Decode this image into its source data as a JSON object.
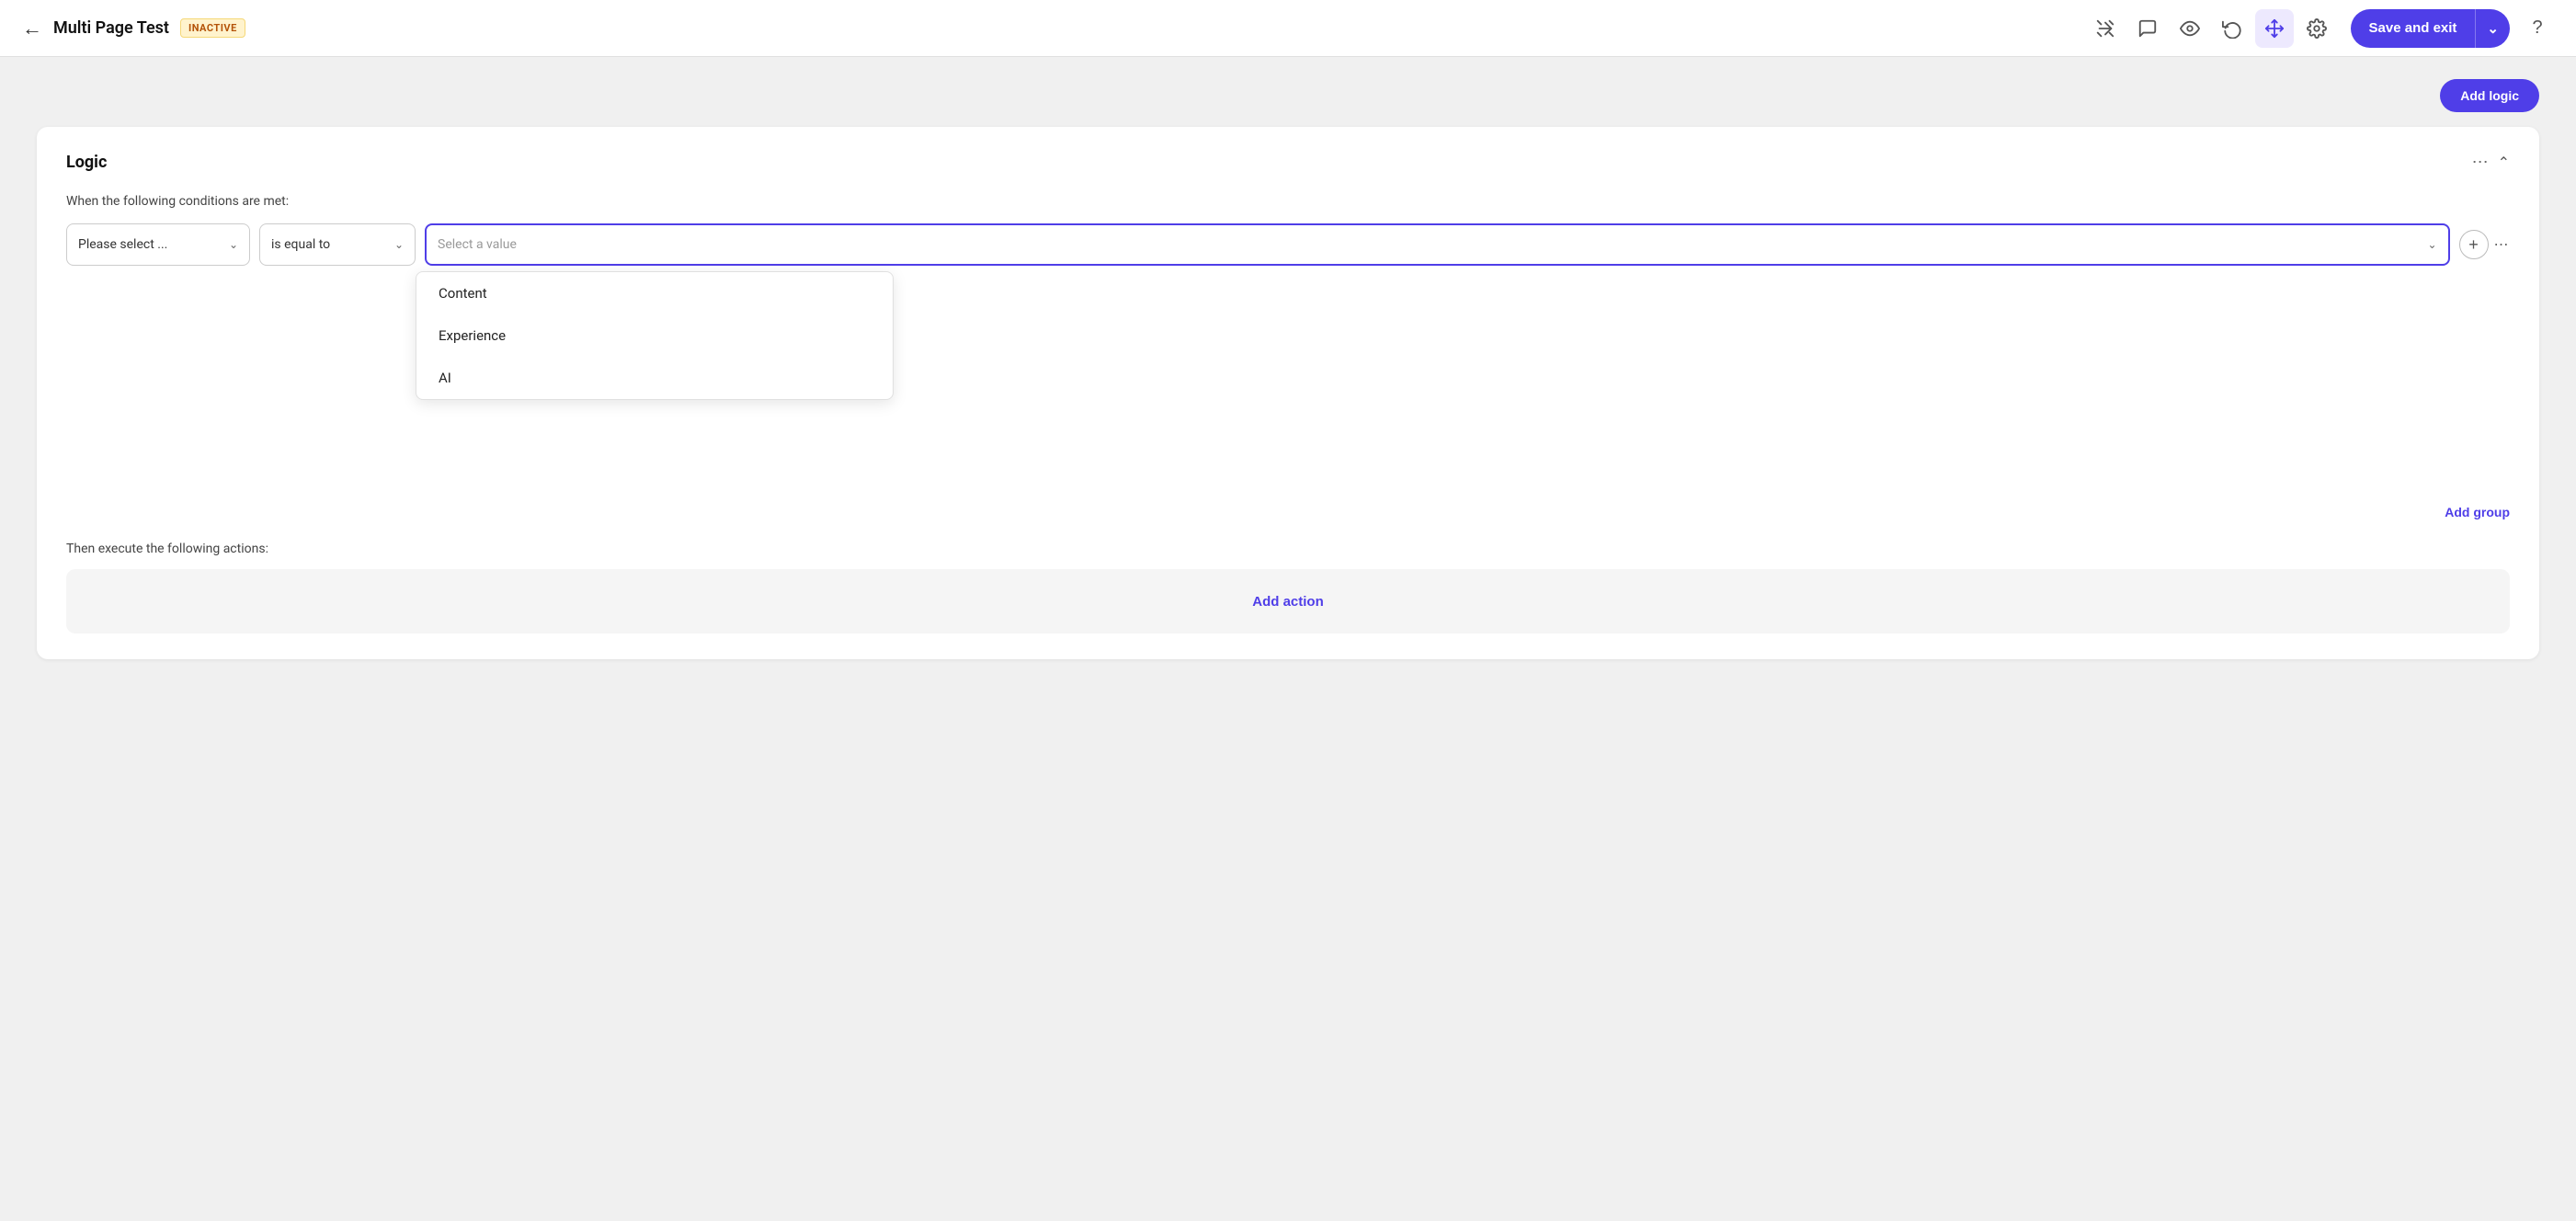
{
  "header": {
    "back_label": "←",
    "title": "Multi Page Test",
    "badge": "INACTIVE",
    "icons": [
      {
        "name": "wand-icon",
        "symbol": "✂️",
        "active": false
      },
      {
        "name": "chat-icon",
        "symbol": "💬",
        "active": false
      },
      {
        "name": "eye-icon",
        "symbol": "👁",
        "active": false
      },
      {
        "name": "history-icon",
        "symbol": "⏱",
        "active": false
      },
      {
        "name": "move-icon",
        "symbol": "✦",
        "active": true
      },
      {
        "name": "gear-icon",
        "symbol": "⚙",
        "active": false
      }
    ],
    "save_exit_label": "Save and exit",
    "help_icon": "?"
  },
  "toolbar": {
    "add_logic_label": "Add logic"
  },
  "logic_card": {
    "title": "Logic",
    "conditions_label": "When the following conditions are met:",
    "please_select_label": "Please select ...",
    "is_equal_to_label": "is equal to",
    "select_value_placeholder": "Select a value",
    "dropdown_options": [
      {
        "label": "Content"
      },
      {
        "label": "Experience"
      },
      {
        "label": "AI"
      }
    ],
    "add_group_label": "Add group",
    "actions_label": "Then execute the following actions:",
    "add_action_label": "Add action"
  }
}
